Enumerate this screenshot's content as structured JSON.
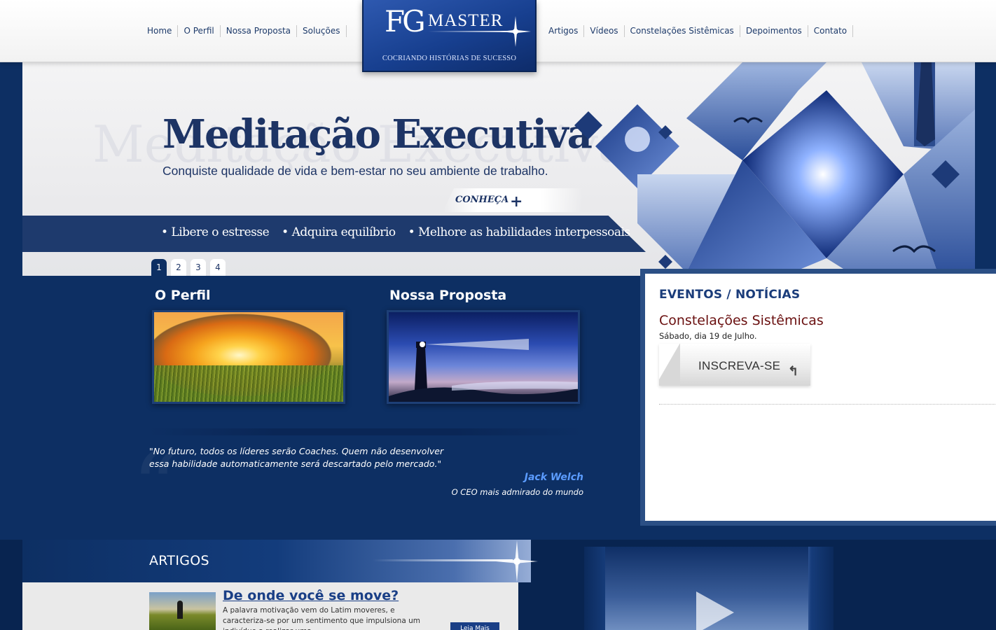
{
  "header": {
    "nav_left": [
      "Home",
      "O Perfil",
      "Nossa Proposta",
      "Soluções"
    ],
    "nav_right": [
      "Artigos",
      "Vídeos",
      "Constelações Sistêmicas",
      "Depoimentos",
      "Contato"
    ],
    "logo": {
      "fg": "FG",
      "master": "MASTER",
      "tagline": "COCRIANDO HISTÓRIAS DE SUCESSO"
    }
  },
  "hero": {
    "title": "Meditação Executiva",
    "subtitle": "Conquiste qualidade de vida e bem-estar no seu ambiente de trabalho.",
    "cta": "CONHEÇA",
    "bullets": [
      "• Libere o estresse",
      "• Adquira equilíbrio",
      "• Melhore as habilidades interpessoais"
    ],
    "pager": [
      "1",
      "2",
      "3",
      "4"
    ],
    "active_page": "1"
  },
  "cards": [
    {
      "title": "O Perfil"
    },
    {
      "title": "Nossa Proposta"
    }
  ],
  "quote": {
    "text": "\"No futuro, todos os líderes serão Coaches. Quem não desenvolver essa habilidade automaticamente será descartado pelo mercado.\"",
    "author": "Jack Welch",
    "author_desc": "O CEO mais admirado do mundo"
  },
  "events": {
    "heading": "EVENTOS / NOTÍCIAS",
    "title": "Constelações Sistêmicas",
    "date": "Sábado, dia 19 de Julho.",
    "button": "INSCREVA-SE"
  },
  "articles": {
    "heading": "ARTIGOS",
    "title": "De onde você se move?",
    "excerpt": "A palavra motivação vem do Latim moveres, e caracteriza-se por um sentimento que impulsiona um indivíduo a realizar uma",
    "more": "Leia Mais"
  },
  "colors": {
    "navy": "#0d2f63",
    "hero_text": "#1d3465",
    "event_title": "#6a1010",
    "author": "#5b9cff"
  }
}
